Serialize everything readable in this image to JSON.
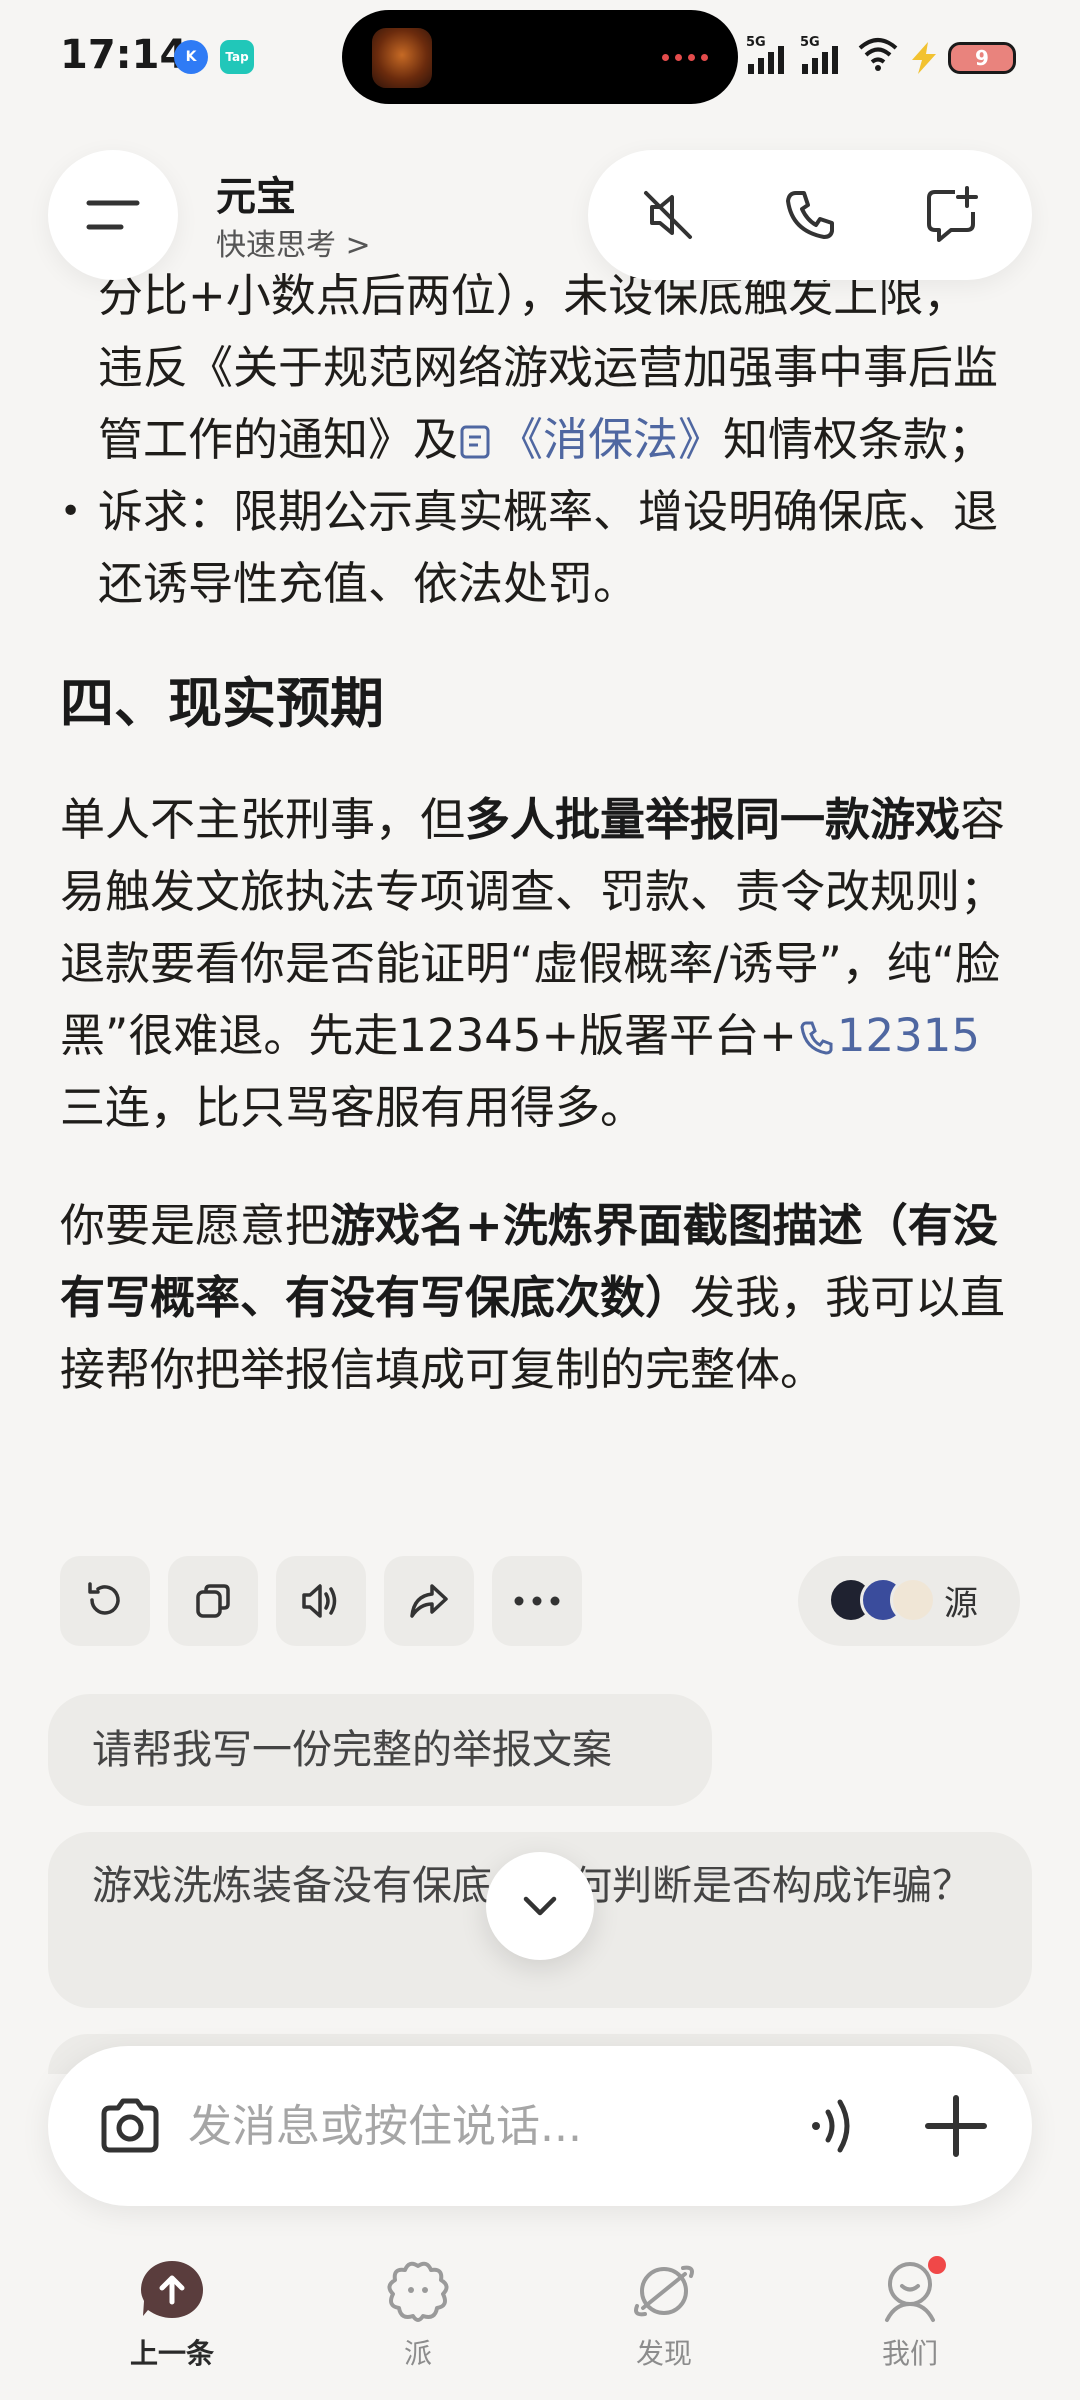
{
  "status_bar": {
    "time": "17:14",
    "badge_k": "K",
    "badge_tap": "Tap",
    "signal_1": "5G",
    "signal_2": "5G",
    "battery": "9"
  },
  "header": {
    "title": "元宝",
    "subtitle": "快速思考 >",
    "actions": [
      "mute-icon",
      "phone-icon",
      "new-chat-icon"
    ]
  },
  "message": {
    "partial_top": "分比+小数点后两位），未设保底触发上限，",
    "p1_a": "违反《关于规范网络游戏运营加强事中事后监管工作的通知》及",
    "p1_link": "《消保法》",
    "p1_b": "知情权条款；",
    "bullet_text": "诉求：限期公示真实概率、增设明确保底、退还诱导性充值、依法处罚。",
    "heading": "四、现实预期",
    "p2_a": "单人不主张刑事，但",
    "p2_bold": "多人批量举报同一款游戏",
    "p2_b": "容易触发文旅执法专项调查、罚款、责令改规则；退款要看你是否能证明“虚假概率/诱导”，纯“脸黑”很难退。先走12345+版署平台+",
    "p2_phone": "12315",
    "p2_c": "三连，比只骂客服有用得多。",
    "p3_a": "你要是愿意把",
    "p3_bold": "游戏名+洗炼界面截图描述（有没有写概率、有没有写保底次数）",
    "p3_b": "发我，我可以直接帮你把举报信填成可复制的完整体。"
  },
  "actions_row": {
    "icons": [
      "refresh-icon",
      "copy-icon",
      "speaker-icon",
      "share-icon",
      "more-icon"
    ],
    "source_label": "源"
  },
  "suggestions": [
    "请帮我写一份完整的举报文案",
    "游戏洗炼装备没有保底，如何判断是否构成诈骗？"
  ],
  "input": {
    "placeholder": "发消息或按住说话..."
  },
  "nav": [
    {
      "label": "上一条",
      "icon": "up-arrow-icon",
      "active": true
    },
    {
      "label": "派",
      "icon": "flower-icon",
      "active": false
    },
    {
      "label": "发现",
      "icon": "planet-icon",
      "active": false
    },
    {
      "label": "我们",
      "icon": "profile-icon",
      "active": false
    }
  ],
  "colors": {
    "background": "#f6f5f3",
    "link": "#4f67a1",
    "notification": "#f04848"
  }
}
